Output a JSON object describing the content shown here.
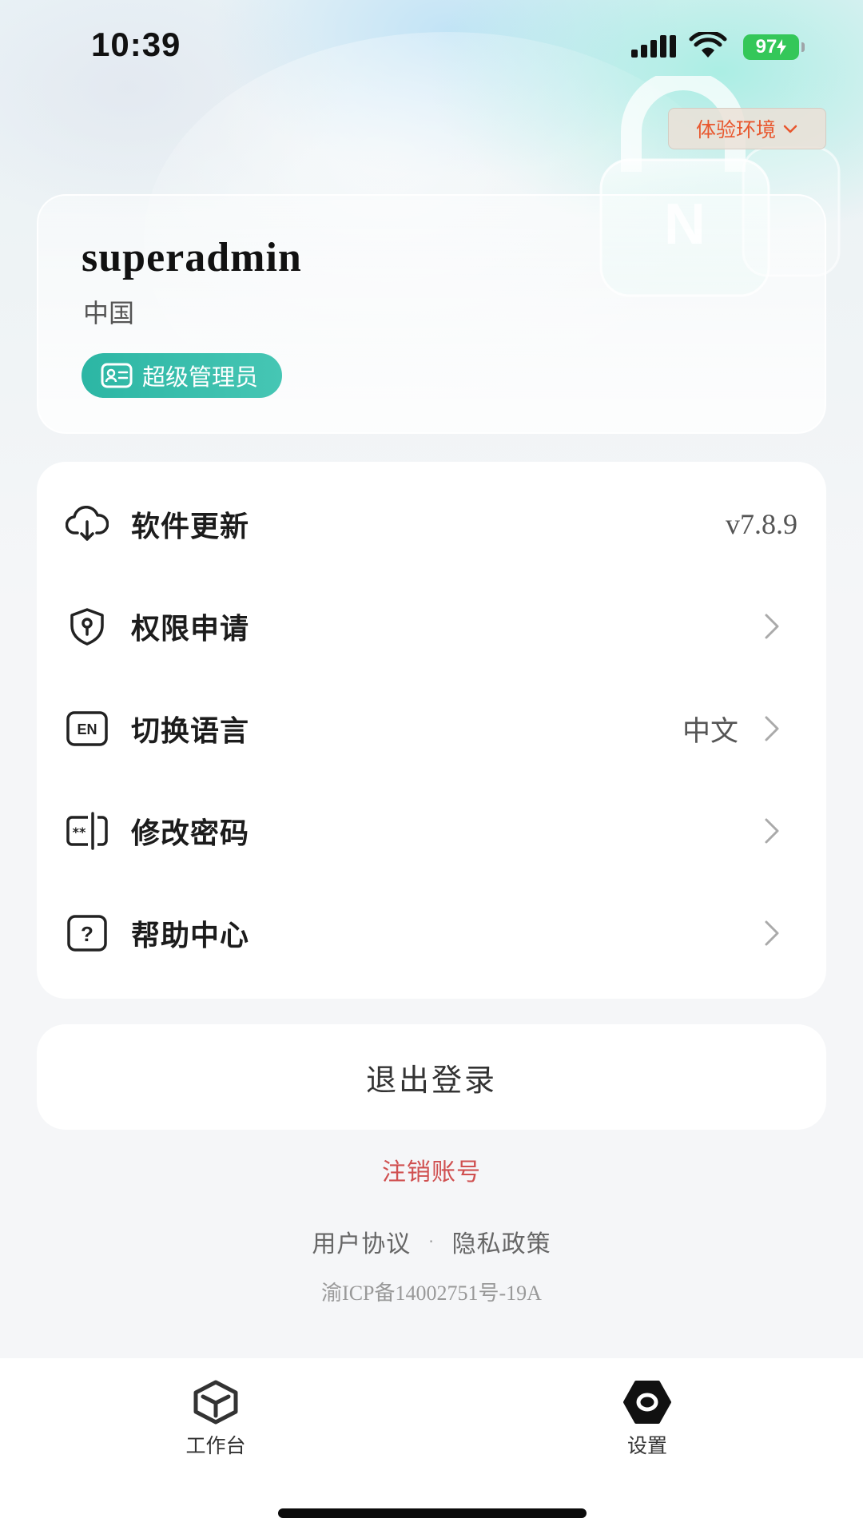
{
  "status_bar": {
    "time": "10:39",
    "battery": "97"
  },
  "env_selector": {
    "label": "体验环境"
  },
  "profile": {
    "username": "superadmin",
    "country": "中国",
    "role": "超级管理员"
  },
  "menu": {
    "items": [
      {
        "label": "软件更新",
        "value": "v7.8.9",
        "icon": "cloud-download-icon"
      },
      {
        "label": "权限申请",
        "value": "",
        "icon": "shield-key-icon"
      },
      {
        "label": "切换语言",
        "value": "中文",
        "icon": "en-language-icon"
      },
      {
        "label": "修改密码",
        "value": "",
        "icon": "password-icon"
      },
      {
        "label": "帮助中心",
        "value": "",
        "icon": "help-icon"
      }
    ]
  },
  "logout": {
    "label": "退出登录"
  },
  "cancel_account": {
    "label": "注销账号"
  },
  "legal": {
    "user_agreement": "用户协议",
    "separator": "·",
    "privacy_policy": "隐私政策",
    "icp": "渝ICP备14002751号-19A"
  },
  "tab_bar": {
    "tabs": [
      {
        "label": "工作台",
        "icon": "cube-icon",
        "active": false
      },
      {
        "label": "设置",
        "icon": "settings-hexagon-icon",
        "active": true
      }
    ]
  },
  "colors": {
    "accent_teal": "#2cb6a4",
    "danger_red": "#d05050",
    "env_orange": "#e8572e",
    "battery_green": "#34c759"
  }
}
